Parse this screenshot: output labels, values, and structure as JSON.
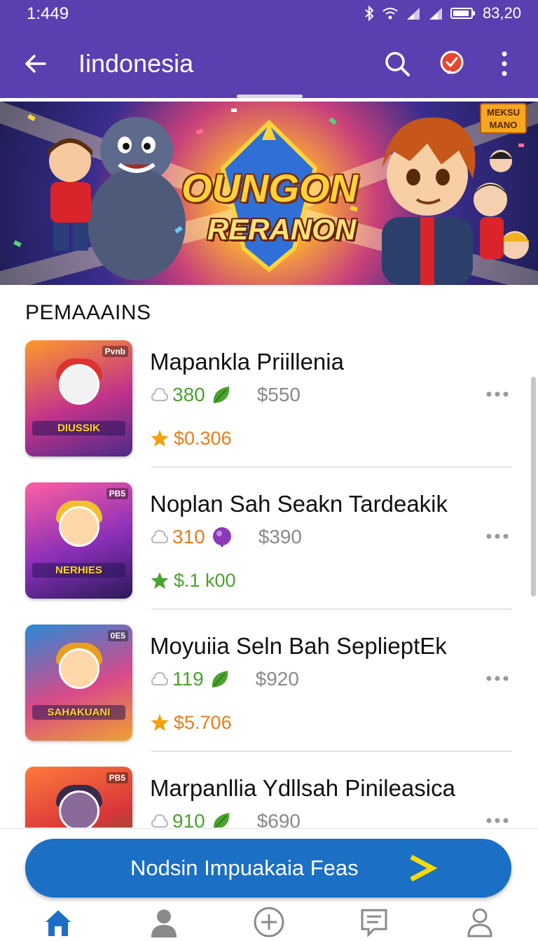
{
  "status_bar": {
    "time": "1:449",
    "battery_text": "83,20"
  },
  "app_bar": {
    "title": "Iindonesia"
  },
  "banner": {
    "title_line1": "OUNGON",
    "title_line2": "RERANON",
    "badge_line1": "MEKSU",
    "badge_line2": "MANO"
  },
  "section": {
    "title": "PEMAAAINS"
  },
  "items": [
    {
      "title": "Mapankla Priillenia",
      "count": "380",
      "count_color": "#4aa32e",
      "leaf": "green-leaf",
      "price": "$550",
      "rating_value": "$0.306",
      "rating_color": "#e77d1b",
      "star_color": "#f2a20c",
      "thumb_tag": "Pvnb",
      "thumb_caption": "DIUSSIK"
    },
    {
      "title": "Noplan Sah Seakn Tardeakik",
      "count": "310",
      "count_color": "#e77d1b",
      "leaf": "purple-bulb",
      "price": "$390",
      "rating_value": "$.1 k00",
      "rating_color": "#4aa32e",
      "star_color": "#4aa32e",
      "thumb_tag": "PB5",
      "thumb_caption": "NERHIES"
    },
    {
      "title": "Moyuiia Seln Bah SeplieptEk",
      "count": "119",
      "count_color": "#4aa32e",
      "leaf": "green-leaf",
      "price": "$920",
      "rating_value": "$5.706",
      "rating_color": "#e77d1b",
      "star_color": "#f2a20c",
      "thumb_tag": "0E5",
      "thumb_caption": "SAHAKUANI"
    },
    {
      "title": "Marpanllia Ydllsah Pinileasica",
      "count": "910",
      "count_color": "#4aa32e",
      "leaf": "green-leaf",
      "price": "$690",
      "rating_value": "",
      "rating_color": "#e77d1b",
      "star_color": "#f2a20c",
      "thumb_tag": "PB5",
      "thumb_caption": ""
    }
  ],
  "cta": {
    "label": "Nodsin Impuakaia Feas"
  },
  "bottom_nav": [
    {
      "icon": "home-icon",
      "active": true
    },
    {
      "icon": "person-icon",
      "active": false
    },
    {
      "icon": "add-circle-icon",
      "active": false
    },
    {
      "icon": "chat-icon",
      "active": false
    },
    {
      "icon": "profile-icon",
      "active": false
    }
  ],
  "colors": {
    "primary": "#5a3fb0",
    "cta": "#1b6fc4",
    "cta_arrow": "#f5d90a",
    "nav_active": "#1b6fc4",
    "nav_inactive": "#8a8a8a"
  }
}
